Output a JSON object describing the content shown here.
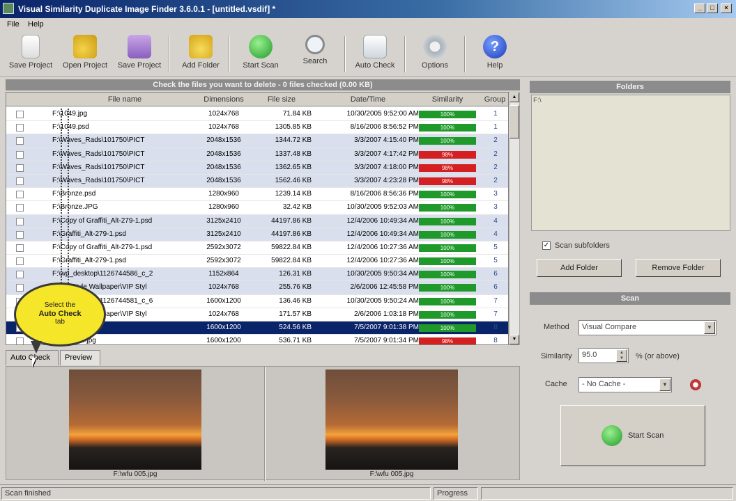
{
  "window": {
    "title": "Visual Similarity Duplicate Image Finder 3.6.0.1 - [untitled.vsdif] *",
    "min": "_",
    "max": "□",
    "close": "×"
  },
  "menu": {
    "file": "File",
    "help": "Help"
  },
  "toolbar": {
    "save_project": "Save Project",
    "open_project": "Open Project",
    "save_project2": "Save Project",
    "add_folder": "Add Folder",
    "start_scan": "Start Scan",
    "search": "Search",
    "auto_check": "Auto Check",
    "options": "Options",
    "help": "Help"
  },
  "results": {
    "header": "Check the files you want to delete - 0 files checked (0.00 KB)",
    "columns": {
      "file_name": "File name",
      "dimensions": "Dimensions",
      "file_size": "File size",
      "date_time": "Date/Time",
      "similarity": "Similarity",
      "group": "Group"
    },
    "rows": [
      {
        "name": "F:\\1049.jpg",
        "dim": "1024x768",
        "size": "71.84 KB",
        "date": "10/30/2005 9:52:00 AM",
        "sim": "100%",
        "sim_color": "#1f9a2a",
        "group": "1",
        "band": false
      },
      {
        "name": "F:\\1049.psd",
        "dim": "1024x768",
        "size": "1305.85 KB",
        "date": "8/16/2006 8:56:52 PM",
        "sim": "100%",
        "sim_color": "#1f9a2a",
        "group": "1",
        "band": false
      },
      {
        "name": "F:\\Waves_Rads\\101750\\PICT",
        "dim": "2048x1536",
        "size": "1344.72 KB",
        "date": "3/3/2007 4:15:40 PM",
        "sim": "100%",
        "sim_color": "#1f9a2a",
        "group": "2",
        "band": true
      },
      {
        "name": "F:\\Waves_Rads\\101750\\PICT",
        "dim": "2048x1536",
        "size": "1337.48 KB",
        "date": "3/3/2007 4:17:42 PM",
        "sim": "98%",
        "sim_color": "#d42020",
        "group": "2",
        "band": true
      },
      {
        "name": "F:\\Waves_Rads\\101750\\PICT",
        "dim": "2048x1536",
        "size": "1362.65 KB",
        "date": "3/3/2007 4:18:00 PM",
        "sim": "98%",
        "sim_color": "#d42020",
        "group": "2",
        "band": true
      },
      {
        "name": "F:\\Waves_Rads\\101750\\PICT",
        "dim": "2048x1536",
        "size": "1562.46 KB",
        "date": "3/3/2007 4:23:28 PM",
        "sim": "98%",
        "sim_color": "#d42020",
        "group": "2",
        "band": true
      },
      {
        "name": "F:\\Bronze.psd",
        "dim": "1280x960",
        "size": "1239.14 KB",
        "date": "8/16/2006 8:56:36 PM",
        "sim": "100%",
        "sim_color": "#1f9a2a",
        "group": "3",
        "band": false
      },
      {
        "name": "F:\\Bronze.JPG",
        "dim": "1280x960",
        "size": "32.42 KB",
        "date": "10/30/2005 9:52:03 AM",
        "sim": "100%",
        "sim_color": "#1f9a2a",
        "group": "3",
        "band": false
      },
      {
        "name": "F:\\Copy of Graffiti_Alt-279-1.psd",
        "dim": "3125x2410",
        "size": "44197.86 KB",
        "date": "12/4/2006 10:49:34 AM",
        "sim": "100%",
        "sim_color": "#1f9a2a",
        "group": "4",
        "band": true
      },
      {
        "name": "F:\\Graffiti_Alt-279-1.psd",
        "dim": "3125x2410",
        "size": "44197.86 KB",
        "date": "12/4/2006 10:49:34 AM",
        "sim": "100%",
        "sim_color": "#1f9a2a",
        "group": "4",
        "band": true
      },
      {
        "name": "F:\\Copy of Graffiti_Alt-279-1.psd",
        "dim": "2592x3072",
        "size": "59822.84 KB",
        "date": "12/4/2006 10:27:36 AM",
        "sim": "100%",
        "sim_color": "#1f9a2a",
        "group": "5",
        "band": false
      },
      {
        "name": "F:\\Graffiti_Alt-279-1.psd",
        "dim": "2592x3072",
        "size": "59822.84 KB",
        "date": "12/4/2006 10:27:36 AM",
        "sim": "100%",
        "sim_color": "#1f9a2a",
        "group": "5",
        "band": false
      },
      {
        "name": "F:\\wp_desktop\\1126744586_c_2",
        "dim": "1152x864",
        "size": "126.31 KB",
        "date": "10/30/2005 9:50:34 AM",
        "sim": "100%",
        "sim_color": "#1f9a2a",
        "group": "6",
        "band": true
      },
      {
        "name": "F:\\XP Style Wallpaper\\VIP Styl",
        "dim": "1024x768",
        "size": "255.76 KB",
        "date": "2/6/2006 12:45:58 PM",
        "sim": "100%",
        "sim_color": "#1f9a2a",
        "group": "6",
        "band": true
      },
      {
        "name": "F:\\wp_desktop\\1126744581_c_6",
        "dim": "1600x1200",
        "size": "136.46 KB",
        "date": "10/30/2005 9:50:24 AM",
        "sim": "100%",
        "sim_color": "#1f9a2a",
        "group": "7",
        "band": false
      },
      {
        "name": "F:\\XP Style Wallpaper\\VIP Styl",
        "dim": "1024x768",
        "size": "171.57 KB",
        "date": "2/6/2006 1:03:18 PM",
        "sim": "100%",
        "sim_color": "#1f9a2a",
        "group": "7",
        "band": false
      },
      {
        "name": "F:\\wfu 005.jpg",
        "dim": "1600x1200",
        "size": "524.56 KB",
        "date": "7/5/2007 9:01:38 PM",
        "sim": "100%",
        "sim_color": "#1f9a2a",
        "group": "8",
        "band": false,
        "selected": true
      },
      {
        "name": "F:\\wfu 005.jpg",
        "dim": "1600x1200",
        "size": "536.71 KB",
        "date": "7/5/2007 9:01:34 PM",
        "sim": "98%",
        "sim_color": "#d42020",
        "group": "8",
        "band": false
      }
    ]
  },
  "tabs": {
    "auto_check": "Auto Check",
    "preview": "Preview"
  },
  "preview": {
    "left_caption": "F:\\wfu 005.jpg",
    "right_caption": "F:\\wfu 005.jpg"
  },
  "folders": {
    "header": "Folders",
    "list_item": "F:\\",
    "scan_subfolders": "Scan subfolders",
    "add_folder": "Add Folder",
    "remove_folder": "Remove Folder"
  },
  "scan": {
    "header": "Scan",
    "method_label": "Method",
    "method_value": "Visual Compare",
    "similarity_label": "Similarity",
    "similarity_value": "95.0",
    "similarity_suffix": "% (or above)",
    "cache_label": "Cache",
    "cache_value": "- No Cache -",
    "start_scan": "Start Scan"
  },
  "callout": {
    "line1": "Select the",
    "line2": "Auto Check",
    "line3": "tab"
  },
  "status": {
    "left": "Scan finished",
    "progress": "Progress"
  },
  "colors": {
    "accent": "#0a246a",
    "match": "#1f9a2a",
    "partial": "#d42020"
  }
}
